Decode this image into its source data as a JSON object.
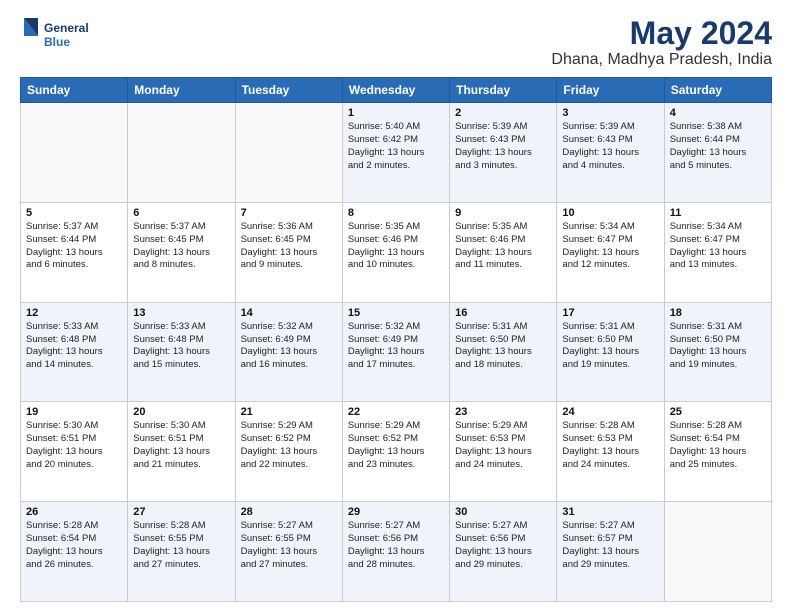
{
  "header": {
    "logo_line1": "General",
    "logo_line2": "Blue",
    "title": "May 2024",
    "subtitle": "Dhana, Madhya Pradesh, India"
  },
  "days_of_week": [
    "Sunday",
    "Monday",
    "Tuesday",
    "Wednesday",
    "Thursday",
    "Friday",
    "Saturday"
  ],
  "weeks": [
    [
      {
        "day": "",
        "info": ""
      },
      {
        "day": "",
        "info": ""
      },
      {
        "day": "",
        "info": ""
      },
      {
        "day": "1",
        "info": "Sunrise: 5:40 AM\nSunset: 6:42 PM\nDaylight: 13 hours\nand 2 minutes."
      },
      {
        "day": "2",
        "info": "Sunrise: 5:39 AM\nSunset: 6:43 PM\nDaylight: 13 hours\nand 3 minutes."
      },
      {
        "day": "3",
        "info": "Sunrise: 5:39 AM\nSunset: 6:43 PM\nDaylight: 13 hours\nand 4 minutes."
      },
      {
        "day": "4",
        "info": "Sunrise: 5:38 AM\nSunset: 6:44 PM\nDaylight: 13 hours\nand 5 minutes."
      }
    ],
    [
      {
        "day": "5",
        "info": "Sunrise: 5:37 AM\nSunset: 6:44 PM\nDaylight: 13 hours\nand 6 minutes."
      },
      {
        "day": "6",
        "info": "Sunrise: 5:37 AM\nSunset: 6:45 PM\nDaylight: 13 hours\nand 8 minutes."
      },
      {
        "day": "7",
        "info": "Sunrise: 5:36 AM\nSunset: 6:45 PM\nDaylight: 13 hours\nand 9 minutes."
      },
      {
        "day": "8",
        "info": "Sunrise: 5:35 AM\nSunset: 6:46 PM\nDaylight: 13 hours\nand 10 minutes."
      },
      {
        "day": "9",
        "info": "Sunrise: 5:35 AM\nSunset: 6:46 PM\nDaylight: 13 hours\nand 11 minutes."
      },
      {
        "day": "10",
        "info": "Sunrise: 5:34 AM\nSunset: 6:47 PM\nDaylight: 13 hours\nand 12 minutes."
      },
      {
        "day": "11",
        "info": "Sunrise: 5:34 AM\nSunset: 6:47 PM\nDaylight: 13 hours\nand 13 minutes."
      }
    ],
    [
      {
        "day": "12",
        "info": "Sunrise: 5:33 AM\nSunset: 6:48 PM\nDaylight: 13 hours\nand 14 minutes."
      },
      {
        "day": "13",
        "info": "Sunrise: 5:33 AM\nSunset: 6:48 PM\nDaylight: 13 hours\nand 15 minutes."
      },
      {
        "day": "14",
        "info": "Sunrise: 5:32 AM\nSunset: 6:49 PM\nDaylight: 13 hours\nand 16 minutes."
      },
      {
        "day": "15",
        "info": "Sunrise: 5:32 AM\nSunset: 6:49 PM\nDaylight: 13 hours\nand 17 minutes."
      },
      {
        "day": "16",
        "info": "Sunrise: 5:31 AM\nSunset: 6:50 PM\nDaylight: 13 hours\nand 18 minutes."
      },
      {
        "day": "17",
        "info": "Sunrise: 5:31 AM\nSunset: 6:50 PM\nDaylight: 13 hours\nand 19 minutes."
      },
      {
        "day": "18",
        "info": "Sunrise: 5:31 AM\nSunset: 6:50 PM\nDaylight: 13 hours\nand 19 minutes."
      }
    ],
    [
      {
        "day": "19",
        "info": "Sunrise: 5:30 AM\nSunset: 6:51 PM\nDaylight: 13 hours\nand 20 minutes."
      },
      {
        "day": "20",
        "info": "Sunrise: 5:30 AM\nSunset: 6:51 PM\nDaylight: 13 hours\nand 21 minutes."
      },
      {
        "day": "21",
        "info": "Sunrise: 5:29 AM\nSunset: 6:52 PM\nDaylight: 13 hours\nand 22 minutes."
      },
      {
        "day": "22",
        "info": "Sunrise: 5:29 AM\nSunset: 6:52 PM\nDaylight: 13 hours\nand 23 minutes."
      },
      {
        "day": "23",
        "info": "Sunrise: 5:29 AM\nSunset: 6:53 PM\nDaylight: 13 hours\nand 24 minutes."
      },
      {
        "day": "24",
        "info": "Sunrise: 5:28 AM\nSunset: 6:53 PM\nDaylight: 13 hours\nand 24 minutes."
      },
      {
        "day": "25",
        "info": "Sunrise: 5:28 AM\nSunset: 6:54 PM\nDaylight: 13 hours\nand 25 minutes."
      }
    ],
    [
      {
        "day": "26",
        "info": "Sunrise: 5:28 AM\nSunset: 6:54 PM\nDaylight: 13 hours\nand 26 minutes."
      },
      {
        "day": "27",
        "info": "Sunrise: 5:28 AM\nSunset: 6:55 PM\nDaylight: 13 hours\nand 27 minutes."
      },
      {
        "day": "28",
        "info": "Sunrise: 5:27 AM\nSunset: 6:55 PM\nDaylight: 13 hours\nand 27 minutes."
      },
      {
        "day": "29",
        "info": "Sunrise: 5:27 AM\nSunset: 6:56 PM\nDaylight: 13 hours\nand 28 minutes."
      },
      {
        "day": "30",
        "info": "Sunrise: 5:27 AM\nSunset: 6:56 PM\nDaylight: 13 hours\nand 29 minutes."
      },
      {
        "day": "31",
        "info": "Sunrise: 5:27 AM\nSunset: 6:57 PM\nDaylight: 13 hours\nand 29 minutes."
      },
      {
        "day": "",
        "info": ""
      }
    ]
  ]
}
